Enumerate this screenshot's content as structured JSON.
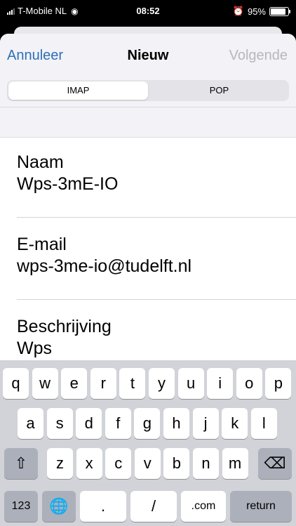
{
  "status": {
    "carrier": "T-Mobile NL",
    "time": "08:52",
    "battery": "95%",
    "battery_level": 0.95
  },
  "nav": {
    "cancel": "Annuleer",
    "title": "Nieuw",
    "next": "Volgende"
  },
  "segments": {
    "imap": "IMAP",
    "pop": "POP"
  },
  "fields": {
    "name_label": "Naam",
    "name_value": "Wps-3mE-IO",
    "email_label": "E-mail",
    "email_value": "wps-3me-io@tudelft.nl",
    "desc_label": "Beschrijving",
    "desc_value": "Wps"
  },
  "keyboard": {
    "row1": [
      "q",
      "w",
      "e",
      "r",
      "t",
      "y",
      "u",
      "i",
      "o",
      "p"
    ],
    "row2": [
      "a",
      "s",
      "d",
      "f",
      "g",
      "h",
      "j",
      "k",
      "l"
    ],
    "row3": [
      "z",
      "x",
      "c",
      "v",
      "b",
      "n",
      "m"
    ],
    "numbers": "123",
    "dot": ".",
    "slash": "/",
    "com": ".com",
    "return": "return"
  }
}
